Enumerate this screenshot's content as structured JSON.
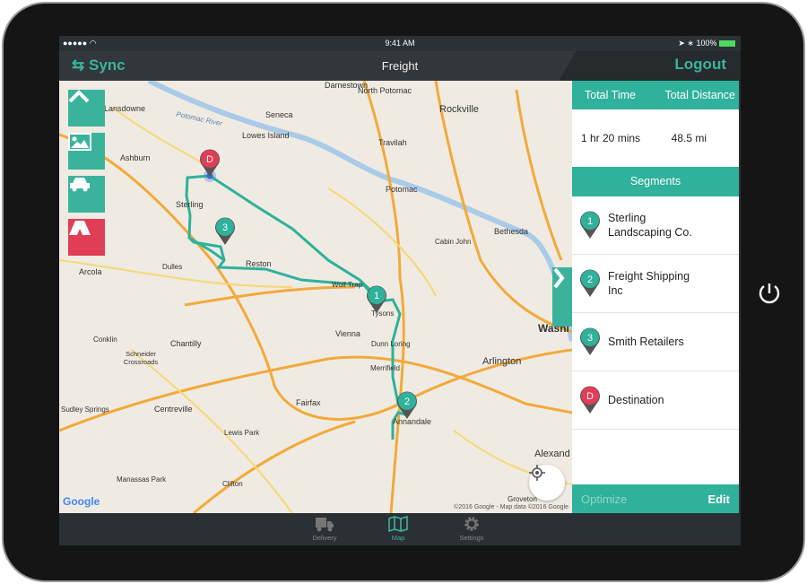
{
  "status_bar": {
    "time": "9:41 AM",
    "battery": "100%"
  },
  "nav": {
    "sync_label": "Sync",
    "title": "Freight",
    "logout_label": "Logout"
  },
  "colors": {
    "accent": "#2fb19b",
    "destination": "#e23d56",
    "nav_bg": "#32373b"
  },
  "map": {
    "places": [
      "Darnestown",
      "North Potomac",
      "Rockville",
      "Lansdowne",
      "Seneca",
      "Lowes Island",
      "Travilah",
      "Ashburn",
      "Potomac",
      "Sterling",
      "Bethesda",
      "Cabin John",
      "Reston",
      "Dulles",
      "Arcola",
      "Wolf Trap",
      "Tysons",
      "Vienna",
      "Dunn Loring",
      "Conklin",
      "Chantilly",
      "Schneider Crossroads",
      "Arlington",
      "Merrifield",
      "Centreville",
      "Fairfax",
      "Annandale",
      "Sudley Springs",
      "Lewis Park",
      "Alexand",
      "Manassas Park",
      "Clifton",
      "Groveton",
      "Washi",
      "Potomac River"
    ],
    "markers": [
      "D",
      "1",
      "2",
      "3"
    ],
    "controls": [
      {
        "icon": "chevron-up-icon"
      },
      {
        "icon": "image-icon"
      },
      {
        "icon": "car-icon"
      },
      {
        "icon": "road-icon"
      }
    ],
    "google_logo": "Google",
    "copyright": "©2016 Google - Map data ©2016 Google"
  },
  "panel": {
    "total_time_label": "Total Time",
    "total_distance_label": "Total Distance",
    "total_time": "1 hr 20 mins",
    "total_distance": "48.5 mi",
    "segments_label": "Segments",
    "segments": [
      {
        "marker": "1",
        "name": "Sterling Landscaping Co."
      },
      {
        "marker": "2",
        "name": "Freight Shipping Inc"
      },
      {
        "marker": "3",
        "name": "Smith Retailers"
      },
      {
        "marker": "D",
        "name": "Destination"
      }
    ],
    "optimize_label": "Optimize",
    "edit_label": "Edit"
  },
  "tabs": [
    {
      "label": "Delivery",
      "icon": "truck-icon"
    },
    {
      "label": "Map",
      "icon": "map-icon",
      "active": true
    },
    {
      "label": "Settings",
      "icon": "gear-icon"
    }
  ]
}
